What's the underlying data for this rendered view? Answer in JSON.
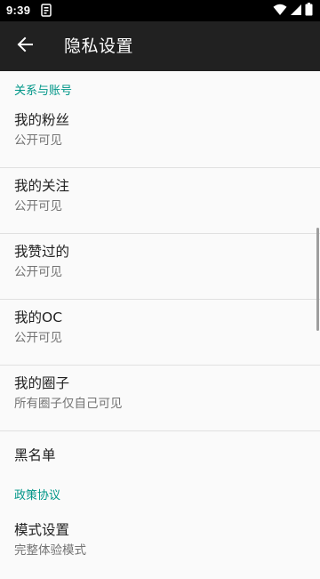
{
  "status_bar": {
    "time": "9:39"
  },
  "app_bar": {
    "title": "隐私设置"
  },
  "sections": {
    "relations": {
      "header": "关系与账号",
      "items": [
        {
          "title": "我的粉丝",
          "subtitle": "公开可见"
        },
        {
          "title": "我的关注",
          "subtitle": "公开可见"
        },
        {
          "title": "我赞过的",
          "subtitle": "公开可见"
        },
        {
          "title": "我的OC",
          "subtitle": "公开可见"
        },
        {
          "title": "我的圈子",
          "subtitle": "所有圈子仅自己可见"
        },
        {
          "title": "黑名单"
        }
      ]
    },
    "policy": {
      "header": "政策协议",
      "items": [
        {
          "title": "模式设置",
          "subtitle": "完整体验模式"
        }
      ]
    }
  },
  "colors": {
    "status_bar": "#000000",
    "app_bar": "#212121",
    "accent": "#009688",
    "background": "#fafafa",
    "divider": "#e0e0e0"
  },
  "icons": {
    "back": "arrow-back-icon",
    "notification": "notification-icon",
    "wifi": "wifi-icon",
    "signal": "cell-signal-icon",
    "battery": "battery-icon"
  }
}
